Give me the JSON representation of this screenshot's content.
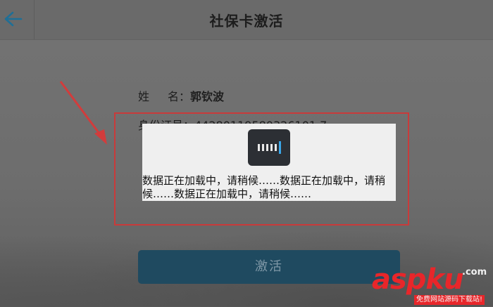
{
  "header": {
    "title": "社保卡激活",
    "back_icon": "arrow-left-icon"
  },
  "form": {
    "name_label_1": "姓",
    "name_label_2": "名：",
    "name_value": "郭钦波",
    "id_label_value": "身份证号：44280119580326101 7"
  },
  "button": {
    "activate_label": "激活"
  },
  "loading": {
    "message": "数据正在加载中，请稍候……数据正在加载中，请稍候……数据正在加载中，请稍候……",
    "spinner_icon": "loading-spinner-icon"
  },
  "watermark": {
    "logo_text": "aspku",
    "dot_text": ".com",
    "tagline": "免费网站源码下载站!"
  },
  "colors": {
    "annotation_red": "#c93a3a",
    "button_bg": "#1f4a60",
    "watermark_red": "#e8262a"
  }
}
